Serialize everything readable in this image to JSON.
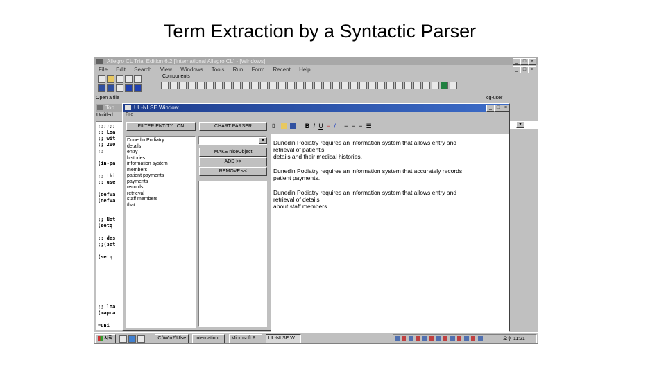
{
  "slide": {
    "title": "Term Extraction by a Syntactic Parser"
  },
  "main_window": {
    "title": "Allegro CL Trial Edition 6.2 [International Allegro CL] - [Windows]",
    "menu": [
      "File",
      "Edit",
      "Search",
      "View",
      "Windows",
      "Tools",
      "Run",
      "Form",
      "Recent",
      "Help"
    ],
    "components_label": "Components",
    "status_left": "Open a file",
    "status_right": "cg-user"
  },
  "lisp_pane": {
    "title": "Top",
    "tab": "Untitled",
    "code_lines": [
      ";;;;;;",
      ";; Loa",
      ";; wit",
      ";; 200",
      ";;",
      "",
      "(in-pa",
      "",
      ";; thi",
      ";; use",
      "",
      "(defva",
      "(defva",
      "",
      "",
      ";; Not",
      "(setq",
      "",
      ";; des",
      ";;(set",
      "",
      "(setq",
      "",
      "",
      "",
      "",
      "",
      "",
      "",
      ";; loa",
      "(mapca",
      "",
      "=uni"
    ]
  },
  "nlse_window": {
    "title": "UL-NLSE Window",
    "menu": [
      "File"
    ],
    "filter_button": "FILTER ENTITY : ON",
    "chart_button": "CHART PARSER",
    "make_button": "MAKE nlseObject",
    "add_button": "ADD >>",
    "remove_button": "REMOVE <<",
    "entities": [
      "Dunedin Podiatry",
      "details",
      "entry",
      "histories",
      "information system",
      "members",
      "patient payments",
      "payments",
      "records",
      "retrieval",
      "staff members",
      "that"
    ],
    "paragraphs": [
      [
        "Dunedin Podiatry requires an information system that allows entry and",
        "retrieval of patient's",
        "details and their medical histories."
      ],
      [
        "Dunedin Podiatry requires an information system that accurately records",
        "patient payments."
      ],
      [
        "Dunedin Podiatry requires an information system that allows entry and",
        "retrieval of details",
        "about staff members."
      ]
    ]
  },
  "taskbar": {
    "start": "시작",
    "items": [
      "C:\\Win2\\Ulse",
      "Internation...",
      "Microsoft P...",
      "UL-NLSE W..."
    ],
    "clock": "오후 11:21"
  },
  "colors": {
    "title_active": "#1e3c8c",
    "window_face": "#c0c0c0"
  }
}
